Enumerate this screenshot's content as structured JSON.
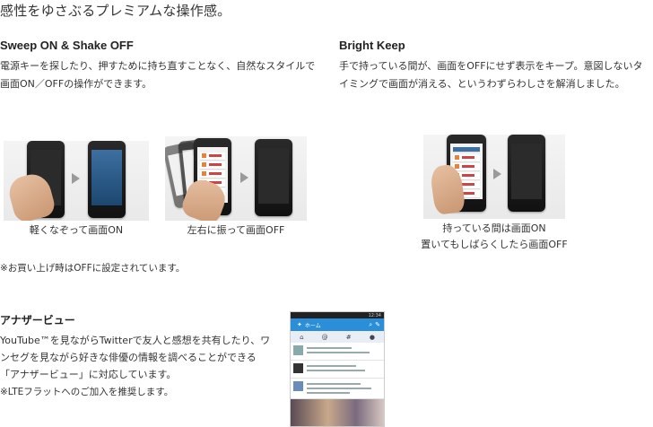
{
  "headline": "感性をゆさぶるプレミアムな操作感。",
  "sweep": {
    "title": "Sweep ON & Shake OFF",
    "description": "電源キーを探したり、押すために持ち直すことなく、自然なスタイルで画面ON／OFFの操作ができます。",
    "caption_left": "軽くなぞって画面ON",
    "caption_right": "左右に振って画面OFF"
  },
  "bright": {
    "title": "Bright Keep",
    "description": "手で持っている間が、画面をOFFにせず表示をキープ。意図しないタイミングで画面が消える、というわずらわしさを解消しました。",
    "caption_line1": "持っている間は画面ON",
    "caption_line2": "置いてもしばらくしたら画面OFF"
  },
  "note_purchase": "※お買い上げ時はOFFに設定されています。",
  "another_view": {
    "title": "アナザービュー",
    "description": "YouTube™を見ながらTwitterで友人と感想を共有したり、ワンセグを見ながら好きな俳優の情報を調べることができる「アナザービュー」に対応しています。",
    "note": "※LTEフラットへのご加入を推奨します。",
    "screen_title": "ホーム",
    "screen_time": "12:34",
    "tab_icons": [
      "home-icon",
      "at-icon",
      "hash-icon",
      "person-icon"
    ],
    "tab_glyphs": [
      "⌂",
      "@",
      "#",
      "●"
    ]
  }
}
